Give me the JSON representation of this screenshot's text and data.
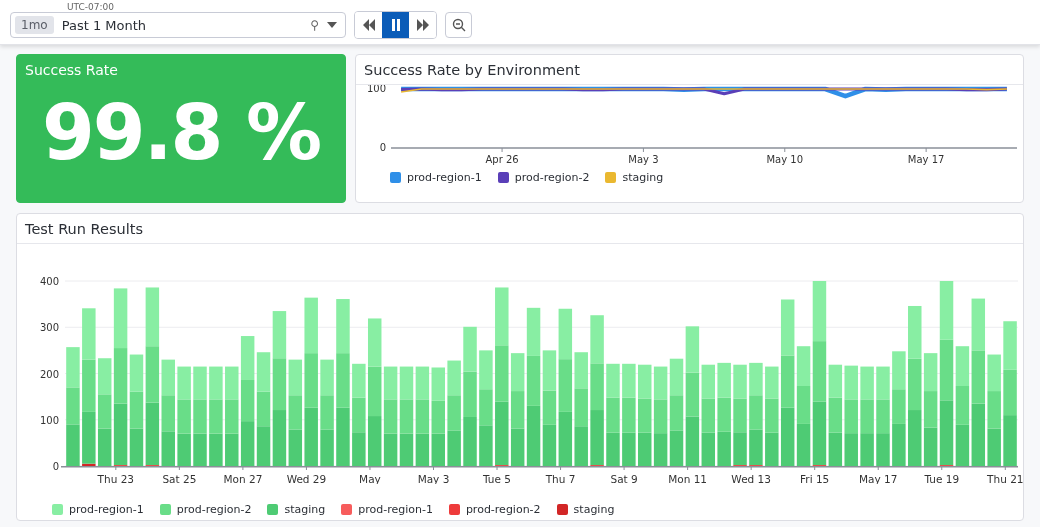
{
  "toolbar": {
    "timezone": "UTC-07:00",
    "range_chip": "1mo",
    "range_label": "Past 1 Month",
    "pin_glyph": "⚲",
    "buttons": [
      {
        "kind": "rewind",
        "selected": false
      },
      {
        "kind": "pause",
        "selected": true
      },
      {
        "kind": "forward",
        "selected": false
      }
    ]
  },
  "success_rate": {
    "title": "Success Rate",
    "value": "99.8 %"
  },
  "env_chart": {
    "title": "Success Rate by Environment",
    "chart_data": {
      "type": "line",
      "categories": [
        null,
        null,
        null,
        null,
        null,
        "Apr 26",
        null,
        null,
        null,
        null,
        null,
        null,
        "May 3",
        null,
        null,
        null,
        null,
        null,
        null,
        "May 10",
        null,
        null,
        null,
        null,
        null,
        null,
        "May 17",
        null,
        null,
        null,
        null
      ],
      "ylim": [
        0,
        100
      ],
      "yticks": [
        0,
        100
      ],
      "series": [
        {
          "name": "prod-region-1",
          "color": "#2f8fe8",
          "values": [
            100,
            100,
            100,
            100,
            100,
            100,
            100,
            100,
            100,
            100,
            100,
            100,
            100,
            100,
            99,
            100,
            100,
            100,
            100,
            100,
            100,
            100,
            88,
            100,
            99,
            100,
            100,
            100,
            100,
            100,
            100
          ]
        },
        {
          "name": "prod-region-2",
          "color": "#5a3fb8",
          "values": [
            99,
            100,
            99,
            99,
            100,
            100,
            100,
            100,
            100,
            99,
            99,
            100,
            100,
            100,
            100,
            100,
            92,
            100,
            100,
            100,
            100,
            100,
            100,
            100,
            100,
            100,
            100,
            100,
            99,
            99,
            100
          ]
        },
        {
          "name": "staging",
          "color": "#eab830",
          "values": [
            95,
            100,
            100,
            100,
            100,
            100,
            100,
            100,
            100,
            100,
            100,
            100,
            100,
            100,
            100,
            100,
            100,
            100,
            100,
            100,
            100,
            100,
            100,
            100,
            100,
            100,
            100,
            100,
            100,
            99,
            100
          ]
        }
      ]
    }
  },
  "test_runs": {
    "title": "Test Run Results",
    "chart_data": {
      "type": "bar",
      "stacked": true,
      "grid": true,
      "ylim": [
        0,
        400
      ],
      "yticks": [
        0,
        100,
        200,
        300,
        400
      ],
      "categories": [
        null,
        null,
        null,
        "Thu 23",
        null,
        null,
        null,
        "Sat 25",
        null,
        null,
        null,
        "Mon 27",
        null,
        null,
        null,
        "Wed 29",
        null,
        null,
        null,
        "May",
        null,
        null,
        null,
        "May 3",
        null,
        null,
        null,
        "Tue 5",
        null,
        null,
        null,
        "Thu 7",
        null,
        null,
        null,
        "Sat 9",
        null,
        null,
        null,
        "Mon 11",
        null,
        null,
        null,
        "Wed 13",
        null,
        null,
        null,
        "Fri 15",
        null,
        null,
        null,
        "May 17",
        null,
        null,
        null,
        "Tue 19",
        null,
        null,
        null,
        "Thu 21"
      ],
      "series": [
        {
          "name": "prod-region-1",
          "color": "#88eea3",
          "values": [
            87,
            111,
            78,
            129,
            80,
            127,
            77,
            71,
            71,
            71,
            71,
            95,
            85,
            102,
            77,
            120,
            77,
            117,
            73,
            104,
            71,
            71,
            71,
            72,
            75,
            97,
            84,
            125,
            82,
            104,
            87,
            109,
            78,
            104,
            73,
            73,
            73,
            71,
            79,
            100,
            73,
            75,
            73,
            70,
            69,
            121,
            86,
            130,
            71,
            73,
            71,
            71,
            82,
            114,
            82,
            127,
            86,
            112,
            79,
            105
          ]
        },
        {
          "name": "prod-region-2",
          "color": "#69dd88",
          "values": [
            80,
            113,
            74,
            120,
            80,
            122,
            78,
            74,
            74,
            74,
            74,
            89,
            75,
            112,
            74,
            118,
            74,
            118,
            75,
            107,
            74,
            74,
            74,
            71,
            76,
            98,
            78,
            122,
            81,
            108,
            74,
            114,
            82,
            101,
            76,
            76,
            74,
            73,
            76,
            95,
            74,
            74,
            73,
            74,
            74,
            113,
            82,
            131,
            76,
            73,
            73,
            73,
            75,
            111,
            79,
            131,
            84,
            115,
            81,
            98
          ]
        },
        {
          "name": "staging",
          "color": "#4ecb74",
          "values": [
            90,
            112,
            81,
            133,
            81,
            135,
            75,
            70,
            70,
            70,
            70,
            97,
            86,
            121,
            79,
            126,
            79,
            126,
            73,
            108,
            70,
            70,
            70,
            70,
            77,
            106,
            88,
            137,
            81,
            130,
            89,
            117,
            86,
            119,
            72,
            72,
            72,
            71,
            77,
            107,
            72,
            74,
            71,
            77,
            72,
            126,
            91,
            137,
            72,
            71,
            71,
            71,
            91,
            121,
            83,
            140,
            89,
            135,
            81,
            110
          ]
        },
        {
          "name": "prod-region-1",
          "color": "#f75c5c",
          "values": [
            0,
            0,
            0,
            0,
            0,
            0,
            0,
            0,
            0,
            0,
            0,
            0,
            0,
            0,
            0,
            0,
            0,
            0,
            0,
            0,
            0,
            0,
            0,
            0,
            0,
            0,
            0,
            0,
            0,
            0,
            0,
            0,
            0,
            0,
            0,
            0,
            0,
            0,
            0,
            0,
            0,
            0,
            0,
            0,
            0,
            0,
            0,
            0,
            0,
            0,
            0,
            0,
            0,
            0,
            0,
            0,
            0,
            0,
            0,
            0
          ]
        },
        {
          "name": "prod-region-2",
          "color": "#ee3b3b",
          "values": [
            0,
            0,
            0,
            2,
            0,
            2,
            0,
            0,
            0,
            0,
            0,
            0,
            0,
            0,
            0,
            0,
            0,
            0,
            0,
            0,
            0,
            0,
            0,
            0,
            0,
            0,
            0,
            2,
            0,
            0,
            0,
            0,
            0,
            2,
            0,
            0,
            0,
            0,
            0,
            0,
            0,
            0,
            2,
            2,
            0,
            0,
            0,
            2,
            0,
            0,
            0,
            0,
            0,
            0,
            0,
            2,
            0,
            0,
            0,
            0
          ]
        },
        {
          "name": "staging",
          "color": "#d22626",
          "values": [
            0,
            5,
            0,
            0,
            0,
            0,
            0,
            0,
            0,
            0,
            0,
            0,
            0,
            0,
            0,
            0,
            0,
            0,
            0,
            0,
            0,
            0,
            0,
            0,
            0,
            0,
            0,
            0,
            0,
            0,
            0,
            0,
            0,
            0,
            0,
            0,
            0,
            0,
            0,
            0,
            0,
            0,
            0,
            0,
            0,
            0,
            0,
            0,
            0,
            0,
            0,
            0,
            0,
            0,
            0,
            0,
            0,
            0,
            0,
            0
          ]
        }
      ]
    }
  }
}
